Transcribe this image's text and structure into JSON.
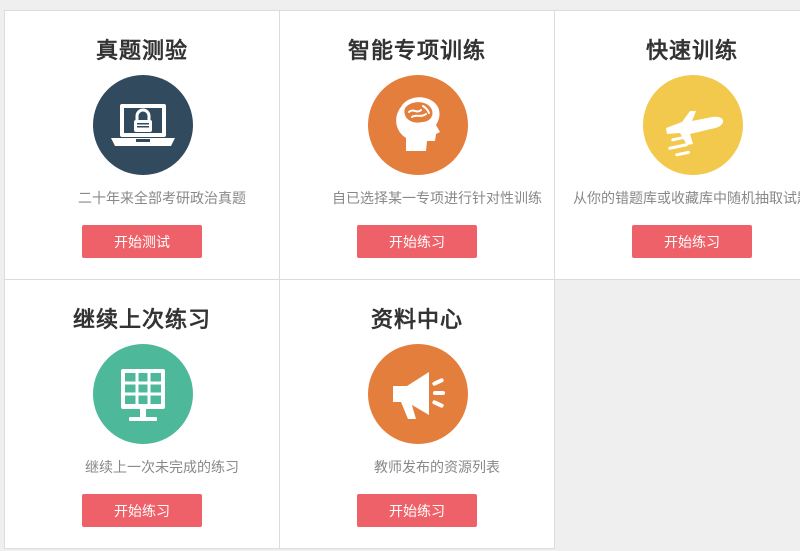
{
  "cards": [
    {
      "title": "真题测验",
      "description": "二十年来全部考研政治真题",
      "button_label": "开始测试",
      "icon": "laptop-lock-icon",
      "icon_color": "#324a5e"
    },
    {
      "title": "智能专项训练",
      "description": "自已选择某一专项进行针对性训练",
      "button_label": "开始练习",
      "icon": "brain-head-icon",
      "icon_color": "#e47e3d"
    },
    {
      "title": "快速训练",
      "description": "从你的错题库或收藏库中随机抽取试题",
      "button_label": "开始练习",
      "icon": "airplane-icon",
      "icon_color": "#f2c94c"
    },
    {
      "title": "继续上次练习",
      "description": "继续上一次未完成的练习",
      "button_label": "开始练习",
      "icon": "monitor-grid-icon",
      "icon_color": "#4db89a"
    },
    {
      "title": "资料中心",
      "description": "教师发布的资源列表",
      "button_label": "开始练习",
      "icon": "megaphone-icon",
      "icon_color": "#e47e3d"
    }
  ],
  "colors": {
    "button": "#ef6168",
    "title": "#333333",
    "description": "#888888",
    "background": "#efefef",
    "card": "#ffffff"
  }
}
